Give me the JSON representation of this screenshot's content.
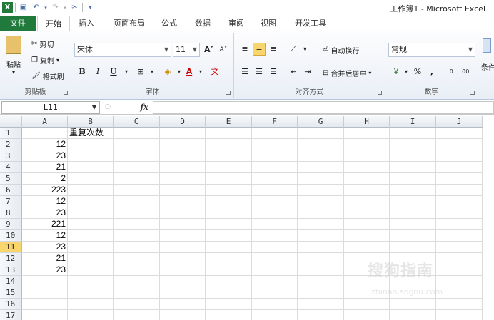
{
  "window_title": "工作簿1 - Microsoft Excel",
  "quick_access": {
    "icons": [
      "excel-logo-icon",
      "save-icon",
      "undo-icon",
      "redo-icon",
      "customize-icon"
    ]
  },
  "tabs": [
    "文件",
    "开始",
    "插入",
    "页面布局",
    "公式",
    "数据",
    "审阅",
    "视图",
    "开发工具"
  ],
  "ribbon": {
    "clipboard": {
      "paste": "粘贴",
      "cut": "剪切",
      "copy": "复制",
      "format_painter": "格式刷",
      "label": "剪贴板"
    },
    "font": {
      "name": "宋体",
      "size": "11",
      "label": "字体",
      "bold": "B",
      "italic": "I",
      "underline": "U"
    },
    "alignment": {
      "wrap": "自动换行",
      "merge": "合并后居中",
      "label": "对齐方式"
    },
    "number": {
      "format": "常规",
      "label": "数字",
      "percent": "%",
      "comma": ","
    },
    "styles": {
      "conditional": "条件"
    }
  },
  "formula_bar": {
    "name_box": "L11",
    "fx": "fx",
    "value": ""
  },
  "sheet": {
    "columns": [
      "A",
      "B",
      "C",
      "D",
      "E",
      "F",
      "G",
      "H",
      "I",
      "J"
    ],
    "rows": [
      "1",
      "2",
      "3",
      "4",
      "5",
      "6",
      "7",
      "8",
      "9",
      "10",
      "11",
      "12",
      "13",
      "14",
      "15",
      "16",
      "17"
    ],
    "selected_row": "11",
    "header_b1": "重复次数",
    "col_a_values": [
      "",
      "12",
      "23",
      "21",
      "2",
      "223",
      "12",
      "23",
      "221",
      "12",
      "23",
      "21",
      "23",
      "",
      "",
      "",
      ""
    ]
  },
  "watermark": {
    "line1": "搜狗指南",
    "line2": "zhinan.sogou.com"
  }
}
